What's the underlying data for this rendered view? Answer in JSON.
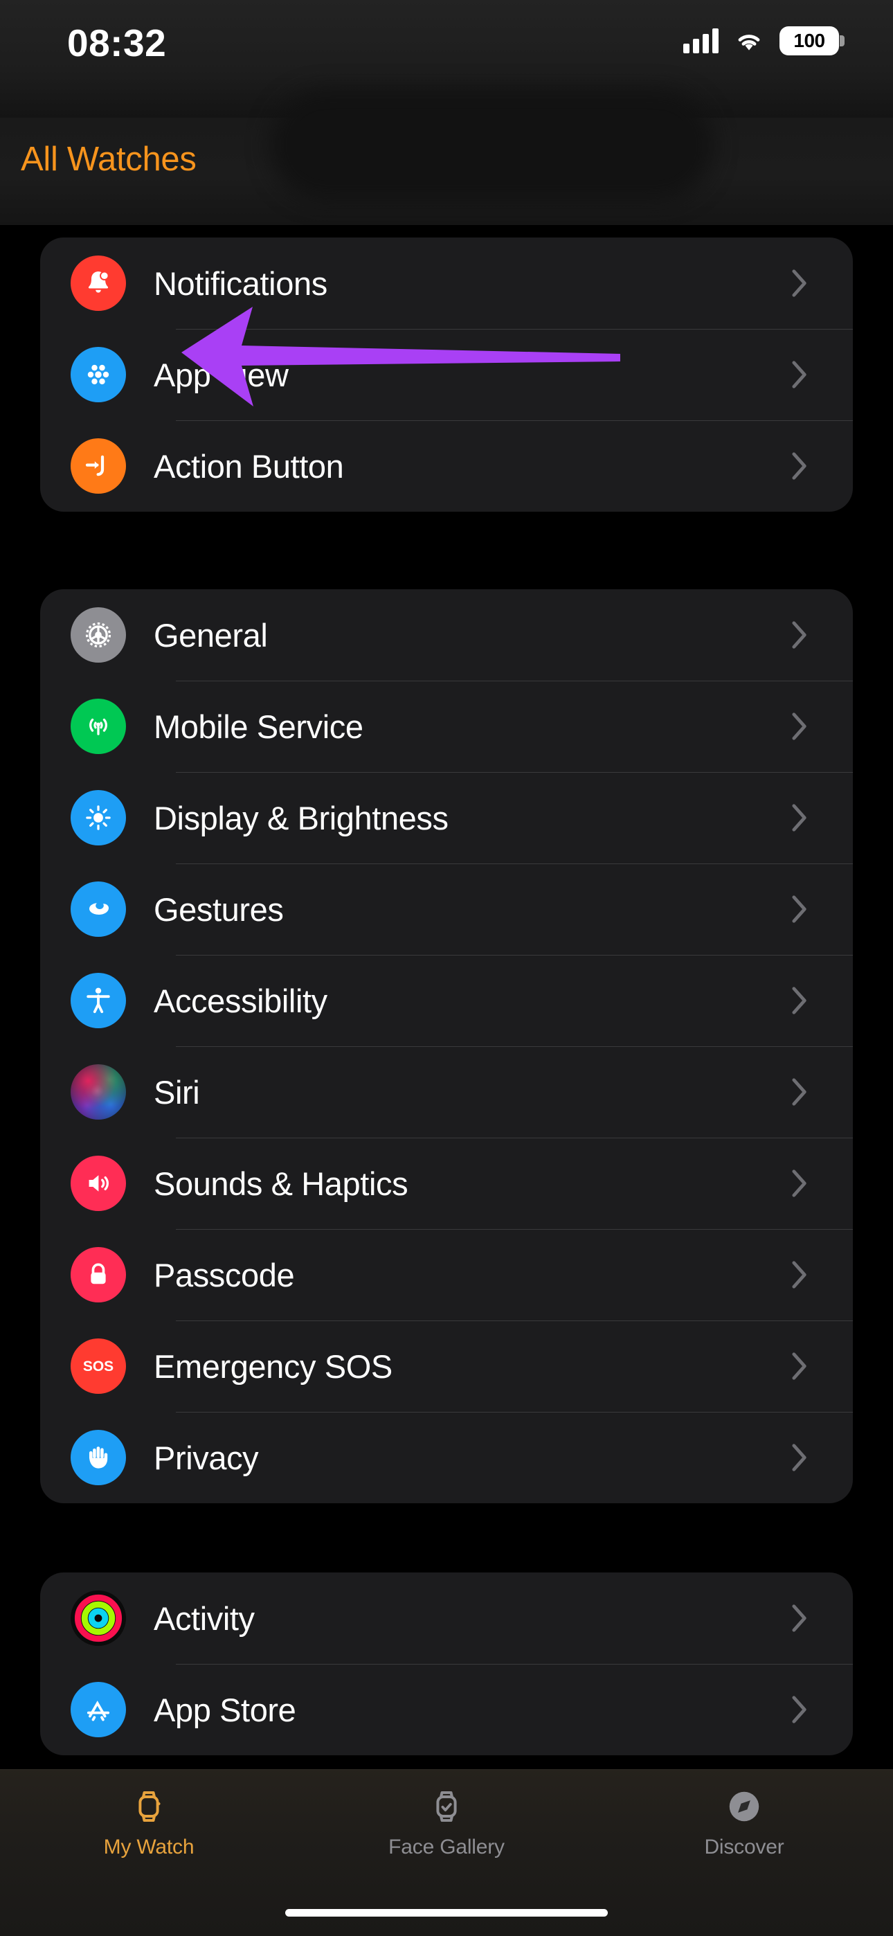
{
  "status_bar": {
    "time": "08:32",
    "signal_icon": "cellular-signal-icon",
    "wifi_icon": "wifi-icon",
    "battery_percent": "100"
  },
  "nav": {
    "back_label": "All Watches"
  },
  "annotation": {
    "arrow_color": "#A940F5",
    "points_at": "General",
    "icon": "left-arrow-annotation"
  },
  "groups": [
    {
      "id": "group-quick",
      "rows": [
        {
          "label": "Notifications",
          "icon": "bell-icon",
          "color": "#FF3B30"
        },
        {
          "label": "App View",
          "icon": "grid-dots-icon",
          "color": "#1E9EF5"
        },
        {
          "label": "Action Button",
          "icon": "action-button-icon",
          "color": "#FF7A17"
        }
      ]
    },
    {
      "id": "group-system",
      "rows": [
        {
          "label": "General",
          "icon": "gear-icon",
          "color": "#8E8E93"
        },
        {
          "label": "Mobile Service",
          "icon": "cell-tower-icon",
          "color": "#00C853"
        },
        {
          "label": "Display & Brightness",
          "icon": "sun-icon",
          "color": "#1E9EF5"
        },
        {
          "label": "Gestures",
          "icon": "hand-gesture-icon",
          "color": "#1E9EF5"
        },
        {
          "label": "Accessibility",
          "icon": "accessibility-icon",
          "color": "#1E9EF5"
        },
        {
          "label": "Siri",
          "icon": "siri-orb-icon",
          "color": "#2D6FE0"
        },
        {
          "label": "Sounds & Haptics",
          "icon": "speaker-icon",
          "color": "#FF2D55"
        },
        {
          "label": "Passcode",
          "icon": "lock-icon",
          "color": "#FF2D55"
        },
        {
          "label": "Emergency SOS",
          "icon": "sos-icon",
          "color": "#FF3B30"
        },
        {
          "label": "Privacy",
          "icon": "hand-raised-icon",
          "color": "#1E9EF5"
        }
      ]
    },
    {
      "id": "group-apps",
      "rows": [
        {
          "label": "Activity",
          "icon": "activity-rings-icon",
          "color": "#000000"
        },
        {
          "label": "App Store",
          "icon": "app-store-icon",
          "color": "#1E9EF5"
        }
      ]
    }
  ],
  "tab_bar": {
    "tabs": [
      {
        "label": "My Watch",
        "icon": "watch-icon",
        "active": true
      },
      {
        "label": "Face Gallery",
        "icon": "gallery-icon",
        "active": false
      },
      {
        "label": "Discover",
        "icon": "compass-icon",
        "active": false
      }
    ],
    "active_color": "#E8A33D",
    "inactive_color": "#8E8E93"
  }
}
